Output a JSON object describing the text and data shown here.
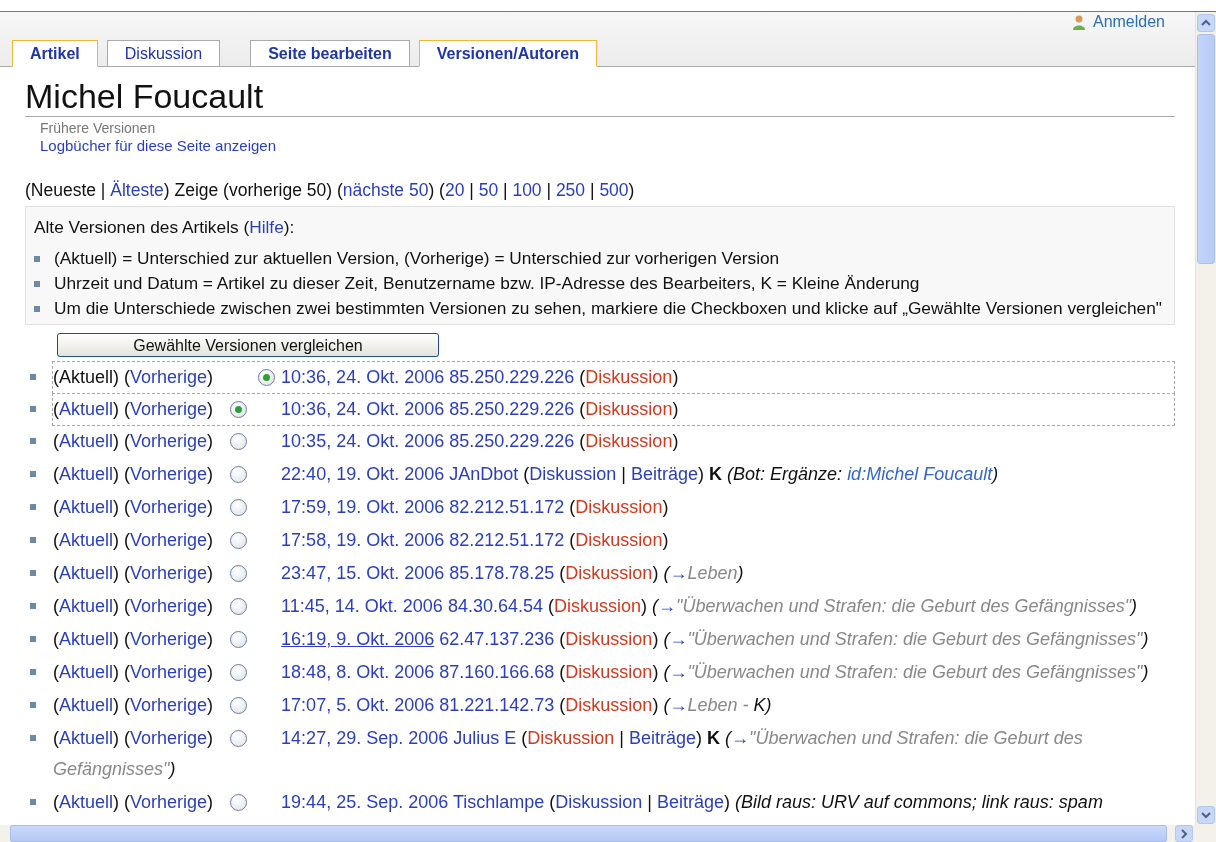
{
  "header": {
    "login": "Anmelden"
  },
  "tabs": [
    {
      "label": "Artikel",
      "kind": "page",
      "selected": true,
      "bold": true
    },
    {
      "label": "Diskussion",
      "kind": "page",
      "selected": false,
      "bold": false
    },
    {
      "label": "Seite bearbeiten",
      "kind": "action",
      "selected": false,
      "bold": true
    },
    {
      "label": "Versionen/Autoren",
      "kind": "action",
      "selected": true,
      "bold": true
    }
  ],
  "title": "Michel Foucault",
  "subtitle": "Frühere Versionen",
  "log_link": "Logbücher für diese Seite anzeigen",
  "pager": [
    {
      "text": "(Neueste | ",
      "link": false
    },
    {
      "text": "Älteste",
      "link": true
    },
    {
      "text": ") Zeige (vorherige 50) (",
      "link": false
    },
    {
      "text": "nächste 50",
      "link": true
    },
    {
      "text": ") (",
      "link": false
    },
    {
      "text": "20",
      "link": true
    },
    {
      "text": " | ",
      "link": false
    },
    {
      "text": "50",
      "link": true
    },
    {
      "text": " | ",
      "link": false
    },
    {
      "text": "100",
      "link": true
    },
    {
      "text": " | ",
      "link": false
    },
    {
      "text": "250",
      "link": true
    },
    {
      "text": " | ",
      "link": false
    },
    {
      "text": "500",
      "link": true
    },
    {
      "text": ")",
      "link": false
    }
  ],
  "legend": {
    "heading": [
      {
        "text": "Alte Versionen des Artikels (",
        "link": false
      },
      {
        "text": "Hilfe",
        "link": true
      },
      {
        "text": "):",
        "link": false
      }
    ],
    "items": [
      "(Aktuell) = Unterschied zur aktuellen Version, (Vorherige) = Unterschied zur vorherigen Version",
      "Uhrzeit und Datum = Artikel zu dieser Zeit, Benutzername bzw. IP-Adresse des Bearbeiters, K = Kleine Änderung",
      "Um die Unterschiede zwischen zwei bestimmten Versionen zu sehen, markiere die Checkboxen und klicke auf „Gewählte Versionen vergleichen\""
    ]
  },
  "compare_button": "Gewählte Versionen vergleichen",
  "revisions": [
    {
      "highlighted": true,
      "links": [
        {
          "kind": "text",
          "text": "(Aktuell) ("
        },
        {
          "kind": "link",
          "text": "Vorherige"
        },
        {
          "kind": "text",
          "text": ")"
        }
      ],
      "diff_radio": {
        "selected": true
      },
      "entry": [
        {
          "kind": "link",
          "text": "10:36, 24. Okt. 2006"
        },
        {
          "kind": "space"
        },
        {
          "kind": "link",
          "text": "85.250.229.226"
        },
        {
          "kind": "text",
          "text": " ("
        },
        {
          "kind": "missing_link",
          "text": "Diskussion"
        },
        {
          "kind": "text",
          "text": ")"
        }
      ]
    },
    {
      "highlighted": true,
      "links": [
        {
          "kind": "text",
          "text": "("
        },
        {
          "kind": "link",
          "text": "Aktuell"
        },
        {
          "kind": "text",
          "text": ") ("
        },
        {
          "kind": "link",
          "text": "Vorherige"
        },
        {
          "kind": "text",
          "text": ")"
        }
      ],
      "old_radio": {
        "selected": true
      },
      "entry": [
        {
          "kind": "link",
          "text": "10:36, 24. Okt. 2006"
        },
        {
          "kind": "space"
        },
        {
          "kind": "link",
          "text": "85.250.229.226"
        },
        {
          "kind": "text",
          "text": " ("
        },
        {
          "kind": "missing_link",
          "text": "Diskussion"
        },
        {
          "kind": "text",
          "text": ")"
        }
      ]
    },
    {
      "highlighted": false,
      "links": [
        {
          "kind": "text",
          "text": "("
        },
        {
          "kind": "link",
          "text": "Aktuell"
        },
        {
          "kind": "text",
          "text": ") ("
        },
        {
          "kind": "link",
          "text": "Vorherige"
        },
        {
          "kind": "text",
          "text": ")"
        }
      ],
      "old_radio": {
        "selected": false
      },
      "entry": [
        {
          "kind": "link",
          "text": "10:35, 24. Okt. 2006"
        },
        {
          "kind": "space"
        },
        {
          "kind": "link",
          "text": "85.250.229.226"
        },
        {
          "kind": "text",
          "text": " ("
        },
        {
          "kind": "missing_link",
          "text": "Diskussion"
        },
        {
          "kind": "text",
          "text": ")"
        }
      ]
    },
    {
      "highlighted": false,
      "links": [
        {
          "kind": "text",
          "text": "("
        },
        {
          "kind": "link",
          "text": "Aktuell"
        },
        {
          "kind": "text",
          "text": ") ("
        },
        {
          "kind": "link",
          "text": "Vorherige"
        },
        {
          "kind": "text",
          "text": ")"
        }
      ],
      "old_radio": {
        "selected": false
      },
      "entry": [
        {
          "kind": "link",
          "text": "22:40, 19. Okt. 2006"
        },
        {
          "kind": "space"
        },
        {
          "kind": "link",
          "text": "JAnDbot"
        },
        {
          "kind": "text",
          "text": " ("
        },
        {
          "kind": "link",
          "text": "Diskussion"
        },
        {
          "kind": "text",
          "text": " | "
        },
        {
          "kind": "link",
          "text": "Beiträge"
        },
        {
          "kind": "text",
          "text": ") "
        },
        {
          "kind": "minor",
          "text": "K"
        },
        {
          "kind": "space"
        },
        {
          "kind": "summary_text",
          "text": "(Bot: Ergänze: "
        },
        {
          "kind": "summary_link",
          "text": "id:Michel Foucault"
        },
        {
          "kind": "summary_text",
          "text": ")"
        }
      ]
    },
    {
      "highlighted": false,
      "links": [
        {
          "kind": "text",
          "text": "("
        },
        {
          "kind": "link",
          "text": "Aktuell"
        },
        {
          "kind": "text",
          "text": ") ("
        },
        {
          "kind": "link",
          "text": "Vorherige"
        },
        {
          "kind": "text",
          "text": ")"
        }
      ],
      "old_radio": {
        "selected": false
      },
      "entry": [
        {
          "kind": "link",
          "text": "17:59, 19. Okt. 2006"
        },
        {
          "kind": "space"
        },
        {
          "kind": "link",
          "text": "82.212.51.172"
        },
        {
          "kind": "text",
          "text": " ("
        },
        {
          "kind": "missing_link",
          "text": "Diskussion"
        },
        {
          "kind": "text",
          "text": ")"
        }
      ]
    },
    {
      "highlighted": false,
      "links": [
        {
          "kind": "text",
          "text": "("
        },
        {
          "kind": "link",
          "text": "Aktuell"
        },
        {
          "kind": "text",
          "text": ") ("
        },
        {
          "kind": "link",
          "text": "Vorherige"
        },
        {
          "kind": "text",
          "text": ")"
        }
      ],
      "old_radio": {
        "selected": false
      },
      "entry": [
        {
          "kind": "link",
          "text": "17:58, 19. Okt. 2006"
        },
        {
          "kind": "space"
        },
        {
          "kind": "link",
          "text": "82.212.51.172"
        },
        {
          "kind": "text",
          "text": " ("
        },
        {
          "kind": "missing_link",
          "text": "Diskussion"
        },
        {
          "kind": "text",
          "text": ")"
        }
      ]
    },
    {
      "highlighted": false,
      "links": [
        {
          "kind": "text",
          "text": "("
        },
        {
          "kind": "link",
          "text": "Aktuell"
        },
        {
          "kind": "text",
          "text": ") ("
        },
        {
          "kind": "link",
          "text": "Vorherige"
        },
        {
          "kind": "text",
          "text": ")"
        }
      ],
      "old_radio": {
        "selected": false
      },
      "entry": [
        {
          "kind": "link",
          "text": "23:47, 15. Okt. 2006"
        },
        {
          "kind": "space"
        },
        {
          "kind": "link",
          "text": "85.178.78.25"
        },
        {
          "kind": "text",
          "text": " ("
        },
        {
          "kind": "missing_link",
          "text": "Diskussion"
        },
        {
          "kind": "text",
          "text": ") "
        },
        {
          "kind": "summary_text",
          "text": "("
        },
        {
          "kind": "summary_arrow",
          "text": "→"
        },
        {
          "kind": "summary_section",
          "text": "Leben"
        },
        {
          "kind": "summary_text",
          "text": ")"
        }
      ]
    },
    {
      "highlighted": false,
      "links": [
        {
          "kind": "text",
          "text": "("
        },
        {
          "kind": "link",
          "text": "Aktuell"
        },
        {
          "kind": "text",
          "text": ") ("
        },
        {
          "kind": "link",
          "text": "Vorherige"
        },
        {
          "kind": "text",
          "text": ")"
        }
      ],
      "old_radio": {
        "selected": false
      },
      "entry": [
        {
          "kind": "link",
          "text": "11:45, 14. Okt. 2006"
        },
        {
          "kind": "space"
        },
        {
          "kind": "link",
          "text": "84.30.64.54"
        },
        {
          "kind": "text",
          "text": " ("
        },
        {
          "kind": "missing_link",
          "text": "Diskussion"
        },
        {
          "kind": "text",
          "text": ") "
        },
        {
          "kind": "summary_text",
          "text": "("
        },
        {
          "kind": "summary_arrow",
          "text": "→"
        },
        {
          "kind": "summary_section",
          "text": "\"Überwachen und Strafen: die Geburt des Gefängnisses\""
        },
        {
          "kind": "summary_text",
          "text": ")"
        }
      ]
    },
    {
      "highlighted": false,
      "links": [
        {
          "kind": "text",
          "text": "("
        },
        {
          "kind": "link",
          "text": "Aktuell"
        },
        {
          "kind": "text",
          "text": ") ("
        },
        {
          "kind": "link",
          "text": "Vorherige"
        },
        {
          "kind": "text",
          "text": ")"
        }
      ],
      "old_radio": {
        "selected": false
      },
      "entry": [
        {
          "kind": "hovered_link",
          "text": "16:19, 9. Okt. 2006"
        },
        {
          "kind": "space"
        },
        {
          "kind": "link",
          "text": "62.47.137.236"
        },
        {
          "kind": "text",
          "text": " ("
        },
        {
          "kind": "missing_link",
          "text": "Diskussion"
        },
        {
          "kind": "text",
          "text": ") "
        },
        {
          "kind": "summary_text",
          "text": "("
        },
        {
          "kind": "summary_arrow",
          "text": "→"
        },
        {
          "kind": "summary_section",
          "text": "\"Überwachen und Strafen: die Geburt des Gefängnisses\""
        },
        {
          "kind": "summary_text",
          "text": ")"
        }
      ]
    },
    {
      "highlighted": false,
      "links": [
        {
          "kind": "text",
          "text": "("
        },
        {
          "kind": "link",
          "text": "Aktuell"
        },
        {
          "kind": "text",
          "text": ") ("
        },
        {
          "kind": "link",
          "text": "Vorherige"
        },
        {
          "kind": "text",
          "text": ")"
        }
      ],
      "old_radio": {
        "selected": false
      },
      "entry": [
        {
          "kind": "link",
          "text": "18:48, 8. Okt. 2006"
        },
        {
          "kind": "space"
        },
        {
          "kind": "link",
          "text": "87.160.166.68"
        },
        {
          "kind": "text",
          "text": " ("
        },
        {
          "kind": "missing_link",
          "text": "Diskussion"
        },
        {
          "kind": "text",
          "text": ") "
        },
        {
          "kind": "summary_text",
          "text": "("
        },
        {
          "kind": "summary_arrow",
          "text": "→"
        },
        {
          "kind": "summary_section",
          "text": "\"Überwachen und Strafen: die Geburt des Gefängnisses\""
        },
        {
          "kind": "summary_text",
          "text": ")"
        }
      ]
    },
    {
      "highlighted": false,
      "links": [
        {
          "kind": "text",
          "text": "("
        },
        {
          "kind": "link",
          "text": "Aktuell"
        },
        {
          "kind": "text",
          "text": ") ("
        },
        {
          "kind": "link",
          "text": "Vorherige"
        },
        {
          "kind": "text",
          "text": ")"
        }
      ],
      "old_radio": {
        "selected": false
      },
      "entry": [
        {
          "kind": "link",
          "text": "17:07, 5. Okt. 2006"
        },
        {
          "kind": "space"
        },
        {
          "kind": "link",
          "text": "81.221.142.73"
        },
        {
          "kind": "text",
          "text": " ("
        },
        {
          "kind": "missing_link",
          "text": "Diskussion"
        },
        {
          "kind": "text",
          "text": ") "
        },
        {
          "kind": "summary_text",
          "text": "("
        },
        {
          "kind": "summary_arrow",
          "text": "→"
        },
        {
          "kind": "summary_section",
          "text": "Leben - "
        },
        {
          "kind": "summary_text",
          "text": "K)"
        }
      ]
    },
    {
      "highlighted": false,
      "links": [
        {
          "kind": "text",
          "text": "("
        },
        {
          "kind": "link",
          "text": "Aktuell"
        },
        {
          "kind": "text",
          "text": ") ("
        },
        {
          "kind": "link",
          "text": "Vorherige"
        },
        {
          "kind": "text",
          "text": ")"
        }
      ],
      "old_radio": {
        "selected": false
      },
      "entry": [
        {
          "kind": "link",
          "text": "14:27, 29. Sep. 2006"
        },
        {
          "kind": "space"
        },
        {
          "kind": "link",
          "text": "Julius E"
        },
        {
          "kind": "text",
          "text": " ("
        },
        {
          "kind": "missing_link",
          "text": "Diskussion"
        },
        {
          "kind": "text",
          "text": " | "
        },
        {
          "kind": "link",
          "text": "Beiträge"
        },
        {
          "kind": "text",
          "text": ") "
        },
        {
          "kind": "minor",
          "text": "K"
        },
        {
          "kind": "space"
        },
        {
          "kind": "summary_text",
          "text": "("
        },
        {
          "kind": "summary_arrow",
          "text": "→"
        },
        {
          "kind": "summary_section",
          "text": "\"Überwachen und Strafen: die Geburt des Gefängnisses\""
        },
        {
          "kind": "summary_text",
          "text": ")"
        }
      ]
    },
    {
      "highlighted": false,
      "links": [
        {
          "kind": "text",
          "text": "("
        },
        {
          "kind": "link",
          "text": "Aktuell"
        },
        {
          "kind": "text",
          "text": ") ("
        },
        {
          "kind": "link",
          "text": "Vorherige"
        },
        {
          "kind": "text",
          "text": ")"
        }
      ],
      "old_radio": {
        "selected": false
      },
      "entry": [
        {
          "kind": "link",
          "text": "19:44, 25. Sep. 2006"
        },
        {
          "kind": "space"
        },
        {
          "kind": "link",
          "text": "Tischlampe"
        },
        {
          "kind": "text",
          "text": " ("
        },
        {
          "kind": "link",
          "text": "Diskussion"
        },
        {
          "kind": "text",
          "text": " | "
        },
        {
          "kind": "link",
          "text": "Beiträge"
        },
        {
          "kind": "text",
          "text": ") "
        },
        {
          "kind": "summary_text",
          "text": "(Bild raus: URV auf commons; link raus: spam"
        }
      ]
    }
  ]
}
